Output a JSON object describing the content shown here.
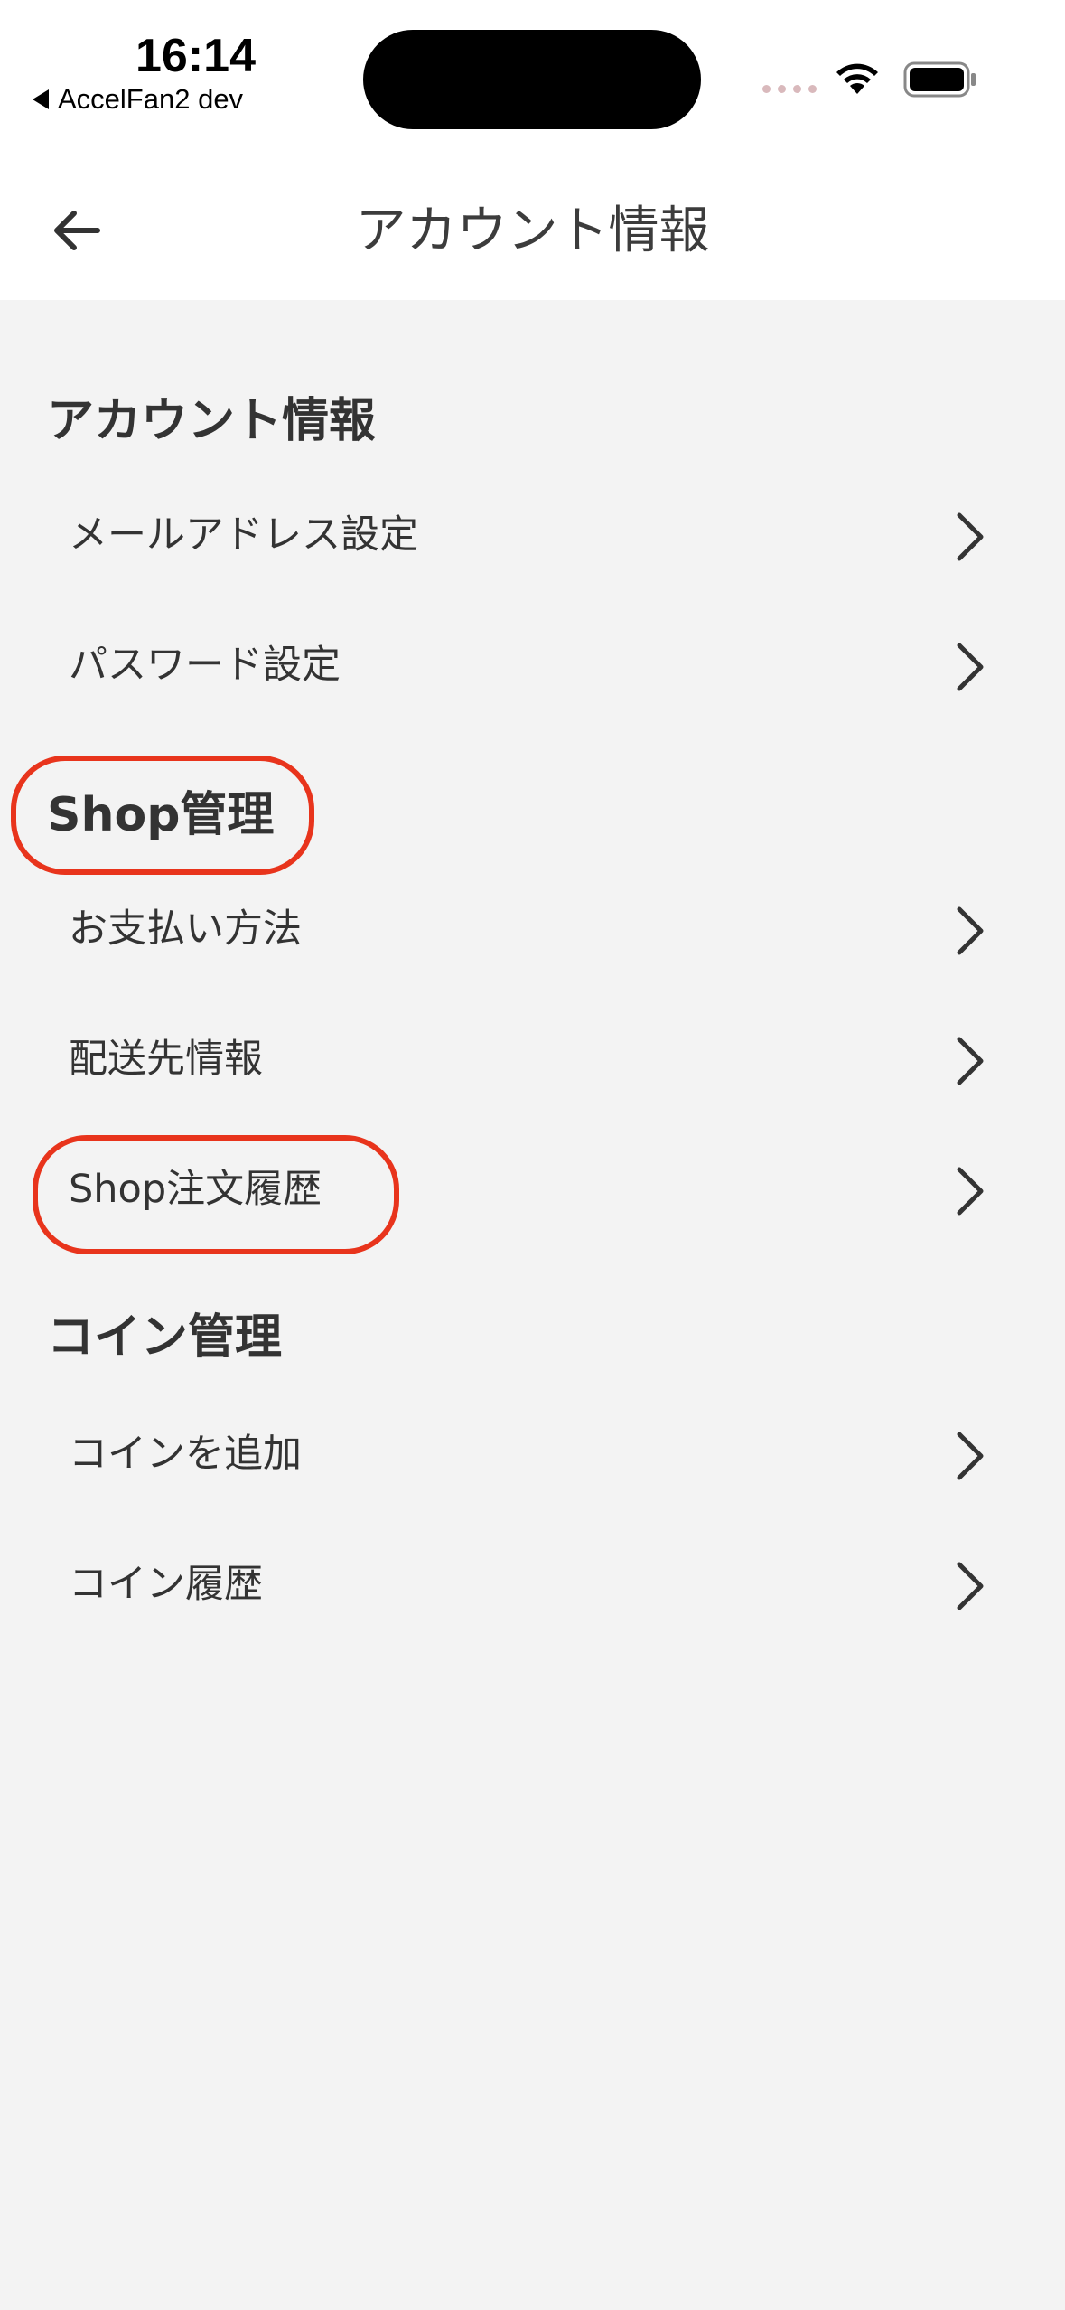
{
  "status_bar": {
    "time": "16:14",
    "back_app": "AccelFan2 dev"
  },
  "nav": {
    "title": "アカウント情報"
  },
  "sections": [
    {
      "title": "アカウント情報",
      "items": [
        "メールアドレス設定",
        "パスワード設定"
      ]
    },
    {
      "title": "Shop管理",
      "items": [
        "お支払い方法",
        "配送先情報",
        "Shop注文履歴"
      ]
    },
    {
      "title": "コイン管理",
      "items": [
        "コインを追加",
        "コイン履歴"
      ]
    }
  ],
  "colors": {
    "header_bg": "#ffffff",
    "page_bg": "#f3f3f3",
    "annotation": "#e8341c"
  },
  "icons": {
    "back": "arrow-left-icon",
    "row": "chevron-right-icon"
  }
}
